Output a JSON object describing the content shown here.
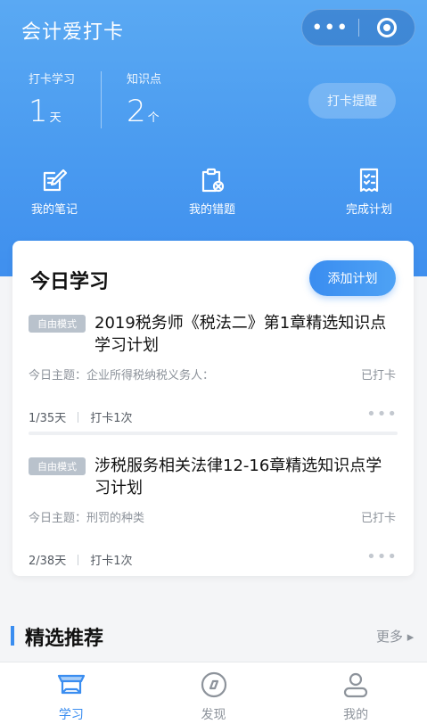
{
  "app": {
    "title": "会计爱打卡",
    "more": "•••"
  },
  "stats": [
    {
      "label": "打卡学习",
      "value": "1",
      "unit": "天"
    },
    {
      "label": "知识点",
      "value": "2",
      "unit": "个"
    }
  ],
  "remind_button": "打卡提醒",
  "quick_actions": [
    {
      "label": "我的笔记",
      "icon": "note-edit-icon"
    },
    {
      "label": "我的错题",
      "icon": "wrong-questions-icon"
    },
    {
      "label": "完成计划",
      "icon": "checklist-icon"
    }
  ],
  "today": {
    "title": "今日学习",
    "add_plan": "添加计划",
    "plans": [
      {
        "badge": "自由模式",
        "title": "2019税务师《税法二》第1章精选知识点学习计划",
        "topic": "今日主题：企业所得税纳税义务人：",
        "status": "已打卡",
        "progress": "1/35天",
        "checkins": "打卡1次",
        "more": "•••"
      },
      {
        "badge": "自由模式",
        "title": "涉税服务相关法律12-16章精选知识点学习计划",
        "topic": "今日主题：刑罚的种类",
        "status": "已打卡",
        "progress": "2/38天",
        "checkins": "打卡1次",
        "more": "•••"
      }
    ]
  },
  "recommend": {
    "title": "精选推荐",
    "more": "更多 ▸"
  },
  "tabbar": [
    {
      "label": "学习",
      "icon": "graduation-cap-icon",
      "active": true
    },
    {
      "label": "发现",
      "icon": "compass-icon",
      "active": false
    },
    {
      "label": "我的",
      "icon": "user-icon",
      "active": false
    }
  ],
  "colors": {
    "primary": "#3a8df0",
    "header": "#4a9bf0",
    "muted": "#8d939b"
  }
}
